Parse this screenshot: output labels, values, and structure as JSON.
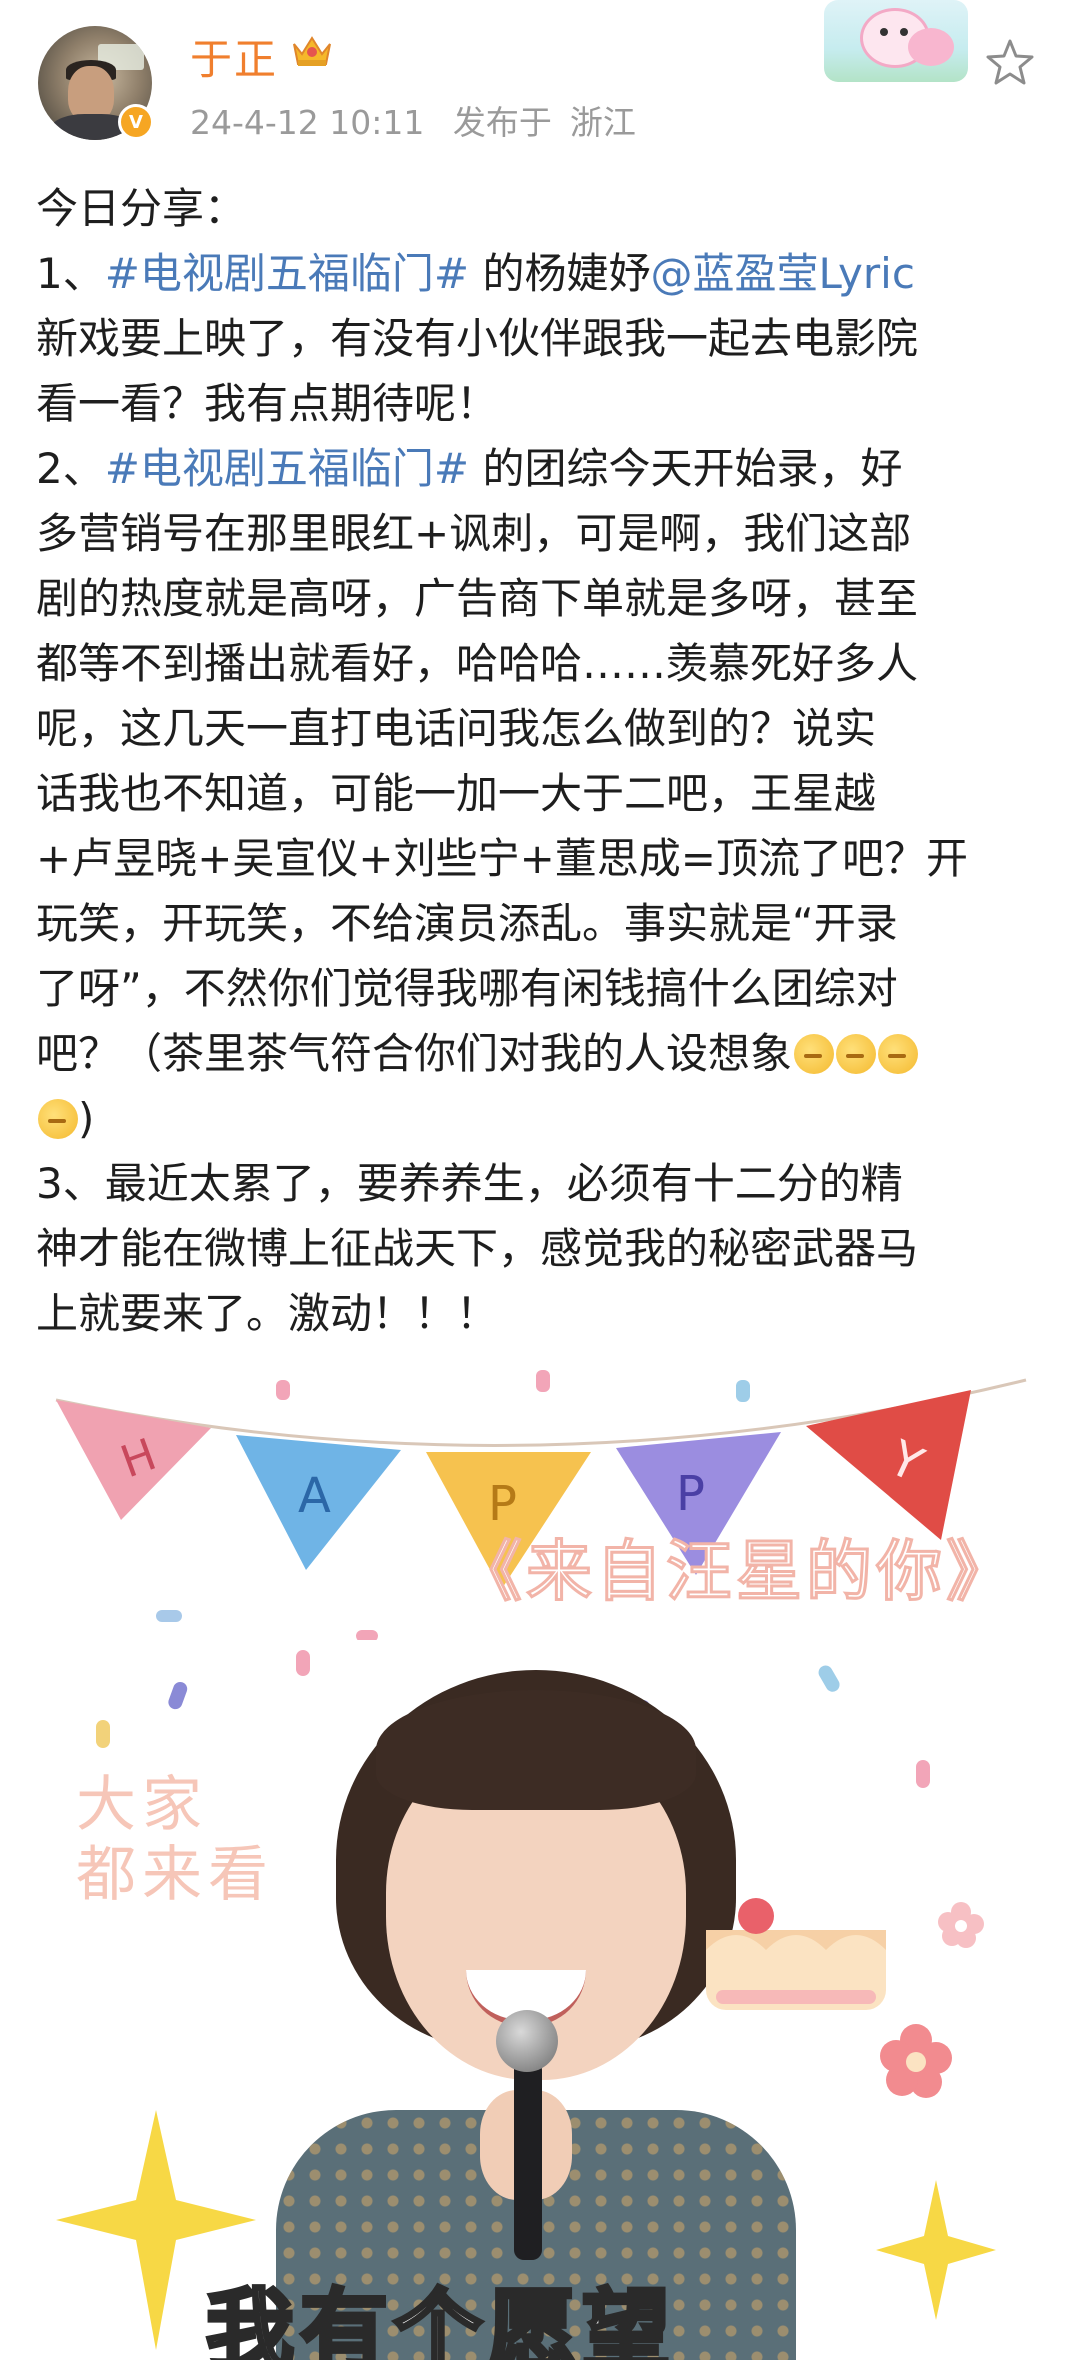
{
  "post": {
    "username": "于正",
    "date": "24-4-12 10:11",
    "location_prefix": "发布于",
    "location": "浙江",
    "icons": {
      "avatar": "avatar",
      "verified": "verified-badge-icon",
      "crown": "crown-icon",
      "star": "star-icon",
      "badge": "pig-cartoon-badge"
    },
    "lines": {
      "l1": "今日分享：",
      "l2_a": "1、",
      "l2_tag": "#电视剧五福临门#",
      "l2_b": " 的杨婕妤",
      "l2_mention": "@蓝盈莹Lyric",
      "l3": "新戏要上映了，有没有小伙伴跟我一起去电影院",
      "l4": "看一看？我有点期待呢！",
      "l5_a": "2、",
      "l5_tag": "#电视剧五福临门#",
      "l5_b": " 的团综今天开始录，好",
      "l6": "多营销号在那里眼红+讽刺，可是啊，我们这部",
      "l7": "剧的热度就是高呀，广告商下单就是多呀，甚至",
      "l8": "都等不到播出就看好，哈哈哈……羡慕死好多人",
      "l9": "呢，这几天一直打电话问我怎么做到的？说实",
      "l10": "话我也不知道，可能一加一大于二吧，王星越",
      "l11": "+卢昱晓+吴宣仪+刘些宁+董思成=顶流了吧？开",
      "l12": "玩笑，开玩笑，不给演员添乱。事实就是“开录",
      "l13": "了呀”，不然你们觉得我哪有闲钱搞什么团综对",
      "l14": "吧？（茶里茶气符合你们对我的人设想象",
      "l15": ")",
      "l16": "3、最近太累了，要养养生，必须有十二分的精",
      "l17": "神才能在微博上征战天下，感觉我的秘密武器马",
      "l18": "上就要来了。激动！！！"
    },
    "colors": {
      "username": "#f07f2e",
      "link": "#4a7ab8",
      "meta": "#9a9a9a"
    }
  },
  "image": {
    "banner_letters": [
      "H",
      "A",
      "P",
      "P",
      "Y"
    ],
    "title": "《来自汪星的你》",
    "side_text_1": "大家",
    "side_text_2": "都来看",
    "caption": "我有个愿望"
  }
}
